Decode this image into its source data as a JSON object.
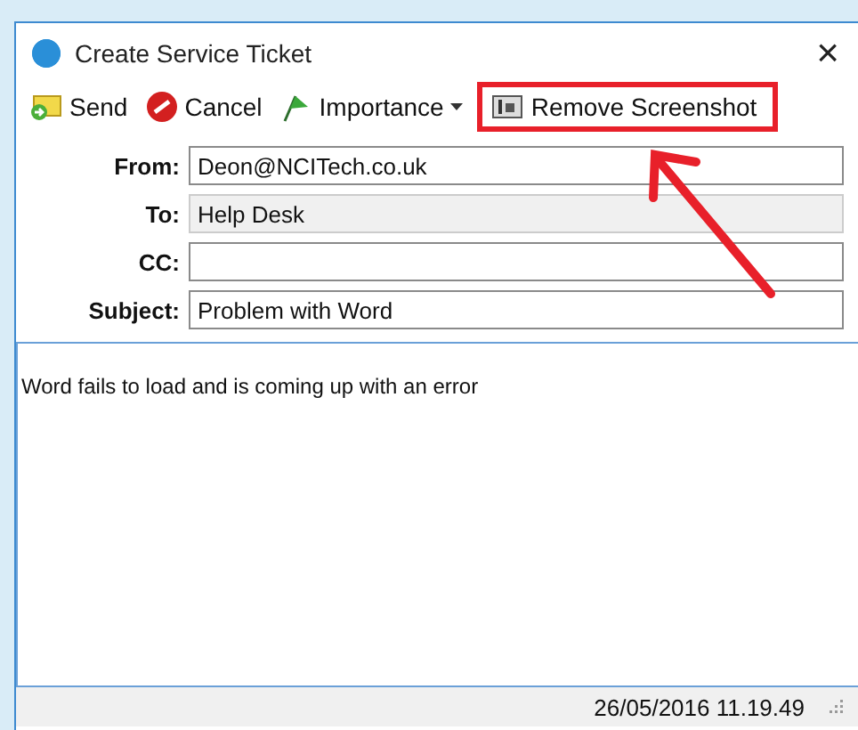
{
  "window": {
    "title": "Create Service Ticket",
    "close": "×"
  },
  "toolbar": [
    {
      "kind": "send",
      "label": "Send"
    },
    {
      "kind": "cancel",
      "label": "Cancel"
    },
    {
      "kind": "importance",
      "label": "Importance",
      "dropdown": true
    },
    {
      "kind": "screenshot",
      "label": "Remove Screenshot",
      "highlighted": true
    }
  ],
  "fields": [
    {
      "label": "From:",
      "value": "Deon@NCITech.co.uk",
      "disabled": false
    },
    {
      "label": "To:",
      "value": "Help Desk",
      "disabled": true
    },
    {
      "label": "CC:",
      "disabled": false
    },
    {
      "label": "Subject:",
      "value": "Problem with Word",
      "disabled": false
    }
  ],
  "body": {
    "value": "Word fails to load and is coming up with an error"
  },
  "status_bar": {
    "timestamp": "26/05/2016 11.19.49"
  }
}
